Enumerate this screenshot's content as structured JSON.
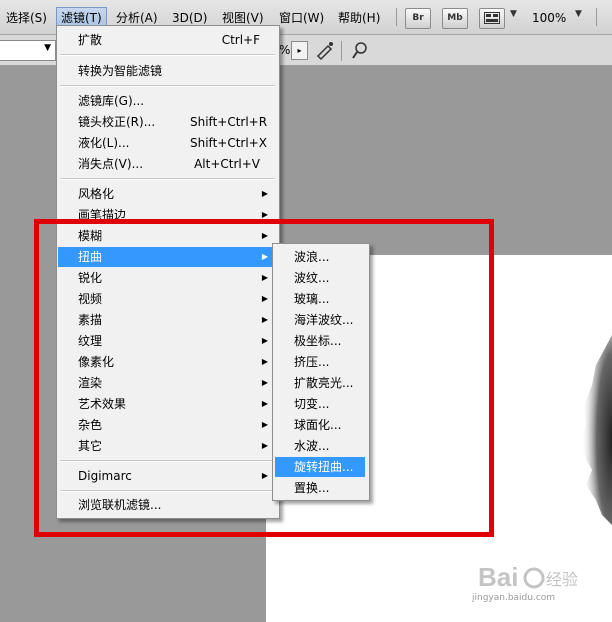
{
  "menubar": {
    "items": [
      "选择(S)",
      "滤镜(T)",
      "分析(A)",
      "3D(D)",
      "视图(V)",
      "窗口(W)",
      "帮助(H)"
    ],
    "buttons": [
      "Br",
      "Mb"
    ],
    "zoom": "100%"
  },
  "optbar": {
    "percent_suffix": "%"
  },
  "filter_menu": {
    "items": [
      {
        "label": "扩散",
        "shortcut": "Ctrl+F"
      },
      {
        "label": "转换为智能滤镜"
      },
      {
        "label": "滤镜库(G)..."
      },
      {
        "label": "镜头校正(R)...",
        "shortcut": "Shift+Ctrl+R"
      },
      {
        "label": "液化(L)...",
        "shortcut": "Shift+Ctrl+X"
      },
      {
        "label": "消失点(V)...",
        "shortcut": "Alt+Ctrl+V"
      },
      {
        "label": "风格化"
      },
      {
        "label": "画笔描边"
      },
      {
        "label": "模糊"
      },
      {
        "label": "扭曲"
      },
      {
        "label": "锐化"
      },
      {
        "label": "视频"
      },
      {
        "label": "素描"
      },
      {
        "label": "纹理"
      },
      {
        "label": "像素化"
      },
      {
        "label": "渲染"
      },
      {
        "label": "艺术效果"
      },
      {
        "label": "杂色"
      },
      {
        "label": "其它"
      },
      {
        "label": "Digimarc"
      },
      {
        "label": "浏览联机滤镜..."
      }
    ]
  },
  "distort_submenu": {
    "items": [
      "波浪...",
      "波纹...",
      "玻璃...",
      "海洋波纹...",
      "极坐标...",
      "挤压...",
      "扩散亮光...",
      "切变...",
      "球面化...",
      "水波...",
      "旋转扭曲...",
      "置换..."
    ]
  },
  "watermark": {
    "url": "jingyan.baidu.com"
  },
  "colors": {
    "highlight": "#3399ff",
    "annotation_box": "#e00000"
  }
}
